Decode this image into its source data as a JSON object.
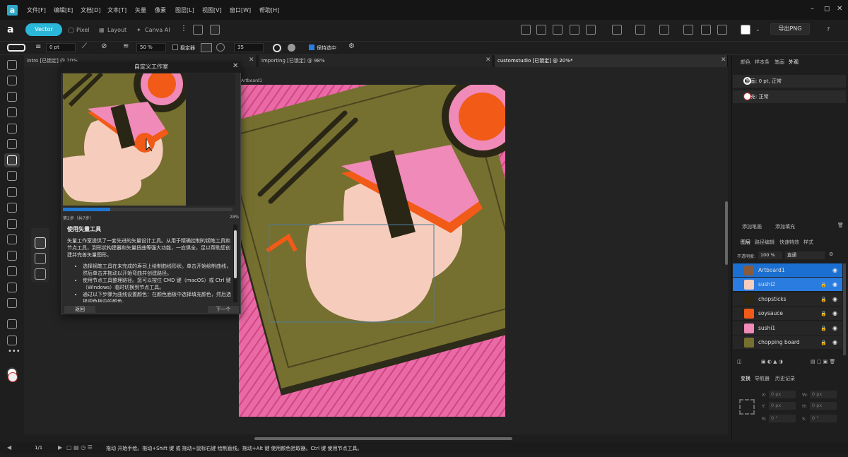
{
  "menu": {
    "items": [
      "文件[F]",
      "编辑[E]",
      "文档[D]",
      "文本[T]",
      "矢量",
      "像素",
      "图层[L]",
      "视图[V]",
      "窗口[W]",
      "帮助[H]"
    ]
  },
  "window_controls": {
    "minimize": "–",
    "restore": "◻",
    "close": "✕"
  },
  "toolbar": {
    "personas": [
      "Vector",
      "Pixel",
      "Layout",
      "Canva AI"
    ],
    "export_label": "导出PNG"
  },
  "context": {
    "stroke_width": "0 pt",
    "opacity": "50 %",
    "stabilizer_label": "稳定器",
    "size_value": "35",
    "keep_selected_label": "保持选中"
  },
  "tabs": [
    {
      "label": "intro [已锁定] @ 20%"
    },
    {
      "label": "importing [已锁定] @ 98%"
    },
    {
      "label": "customstudio [已锁定] @ 20%*"
    }
  ],
  "canvas": {
    "artboard_label": "Artboard1"
  },
  "dialog": {
    "title": "自定义工作室",
    "step_text": "第2步（共7步）",
    "percent_text": "28%",
    "progress": 0.28,
    "heading": "使用矢量工具",
    "intro": "矢量工作室提供了一套先进的矢量设计工具。从用于精确控制的钢笔工具和节点工具，到形状构建器和矢量扭曲等强大功能，一应俱全，足以帮助您创建并完善矢量图形。",
    "bullets": [
      "选择钢笔工具在未完成的寿司上绘制曲线形状。单击开始绘制曲线，然后单击并拖动以开始弯曲并创建路径。",
      "使用节点工具整理路径。您可以按住 CMD 键（macOS）或 Ctrl 键（Windows）临时切换到节点工具。",
      "通过以下步骤为曲线设置颜色：在颜色面板中选择填充颜色，然后选择调色板中的颜色。"
    ],
    "back_label": "返回",
    "next_label": "下一个"
  },
  "right_panel": {
    "top_tabs": [
      "颜色",
      "样本条",
      "笔画",
      "外观"
    ],
    "stroke_row": "笔画: 0 pt, 正常",
    "fill_row": "填充: 正常",
    "add_stroke": "添加笔画",
    "add_fill": "添加填充",
    "layer_tabs": [
      "图层",
      "路径编辑",
      "快速特效",
      "样式"
    ],
    "opacity_label": "不透明度:",
    "opacity_value": "100 %",
    "blend_mode": "直通",
    "layers": [
      {
        "name": "Artboard1"
      },
      {
        "name": "sushi2"
      },
      {
        "name": "chopsticks"
      },
      {
        "name": "soysauce"
      },
      {
        "name": "sushi1"
      },
      {
        "name": "chopping board"
      }
    ],
    "transform_tabs": [
      "变换",
      "导航器",
      "历史记录"
    ],
    "transform": {
      "x_label": "X:",
      "x_value": "0 px",
      "y_label": "Y:",
      "y_value": "0 px",
      "w_label": "W:",
      "w_value": "0 px",
      "h_label": "H:",
      "h_value": "0 px",
      "r_label": "R:",
      "r_value": "0 °",
      "s_label": "S:",
      "s_value": "0 °"
    }
  },
  "status": {
    "page": "1/1",
    "hint": "拖动 开始手绘。拖动+Shift 键 或 拖动+鼠标右键 绘制直线。拖动+Alt 键 使用颜色拾取器。Ctrl 键 使用节点工具。"
  },
  "colors": {
    "accent": "#2bb7d9",
    "selection": "#1b6fd1",
    "artboard_pink": "#e96aa7",
    "board_olive": "#767030"
  }
}
